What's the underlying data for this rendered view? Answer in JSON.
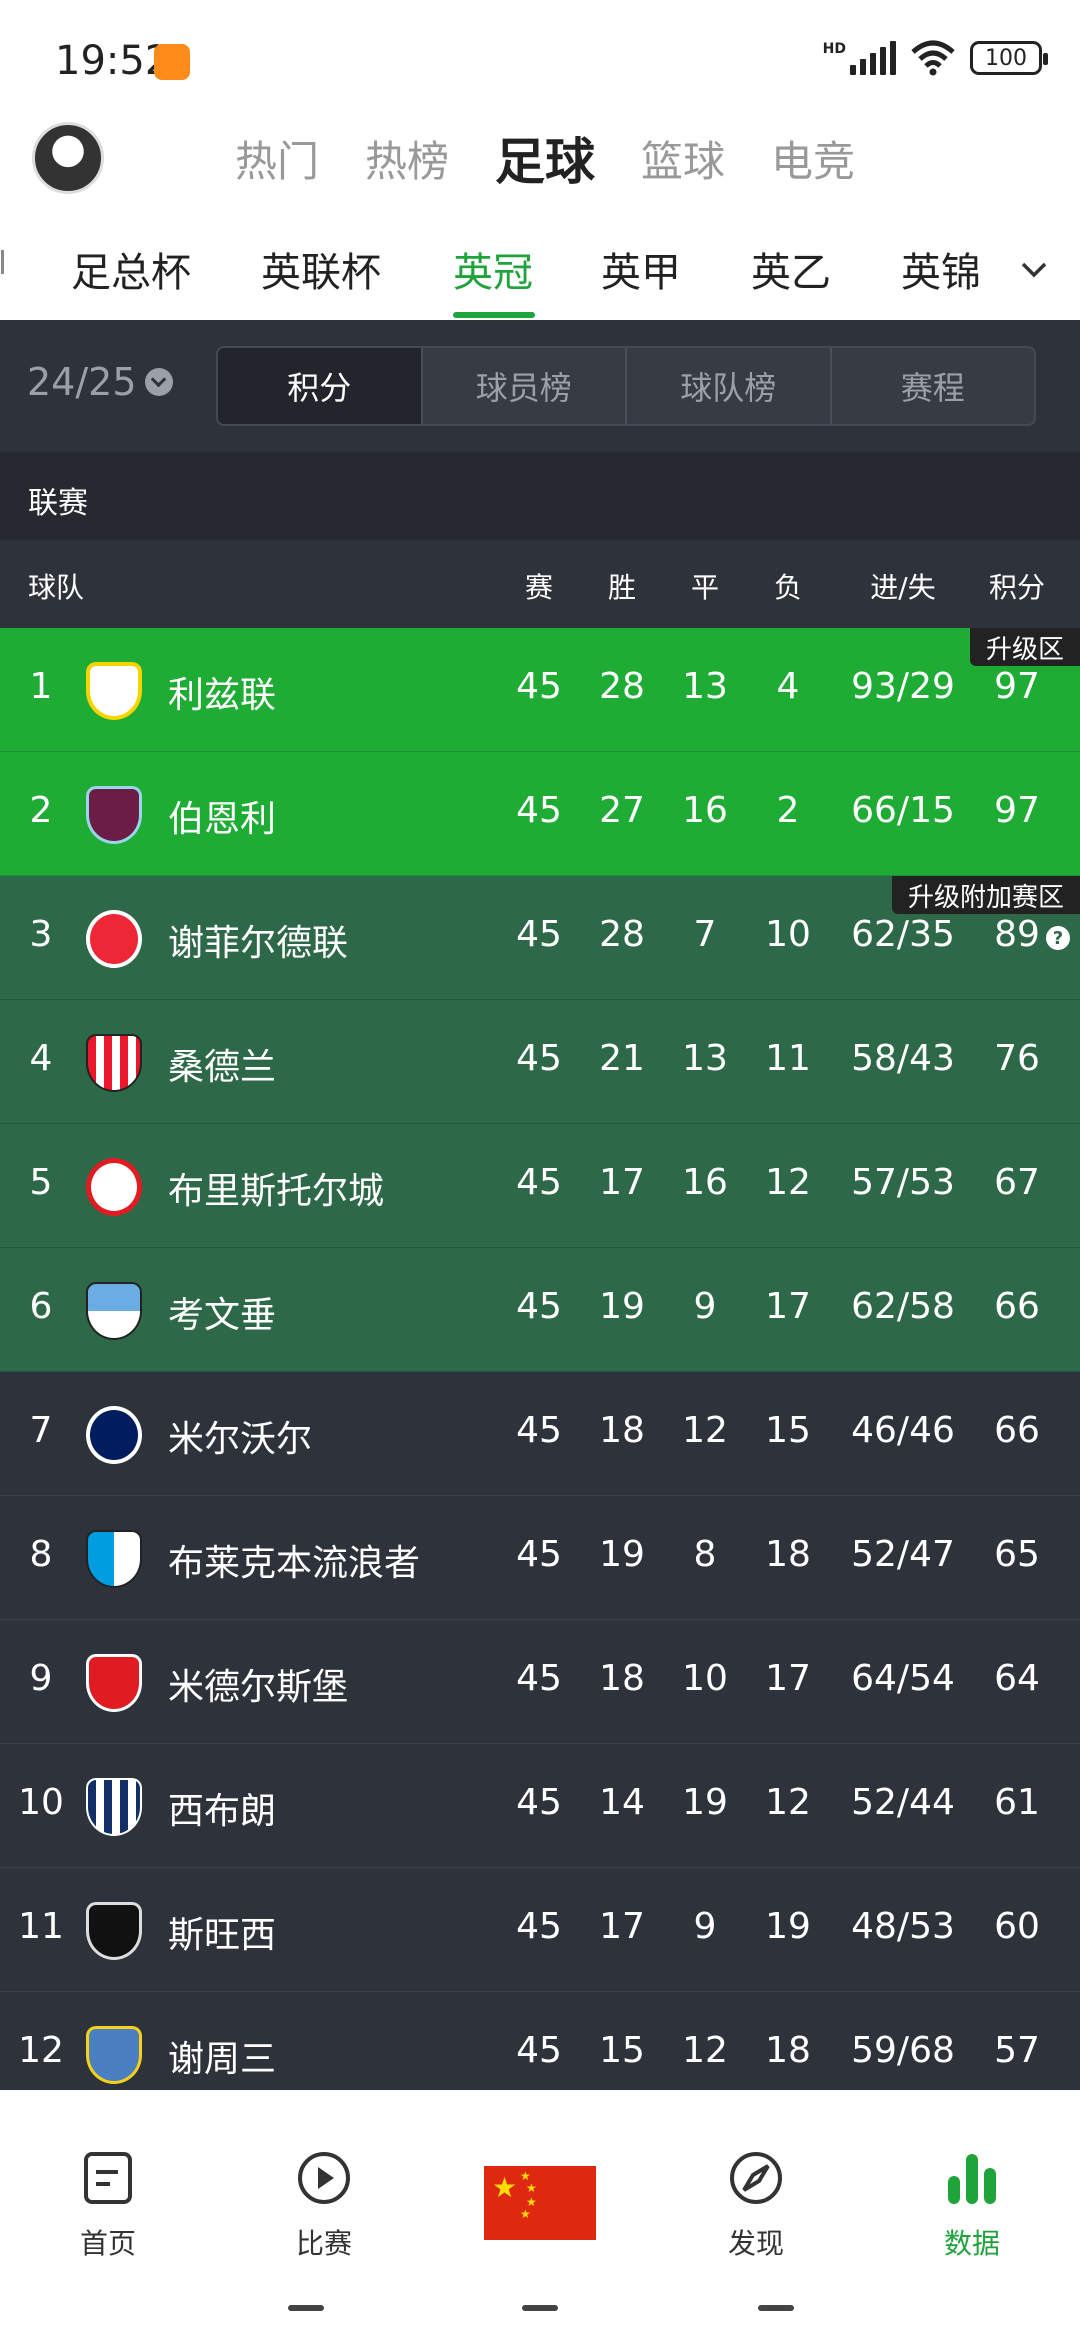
{
  "status": {
    "time": "19:52",
    "battery": "100",
    "network": "HD"
  },
  "main_tabs": [
    {
      "label": "热门",
      "active": false
    },
    {
      "label": "热榜",
      "active": false
    },
    {
      "label": "足球",
      "active": true
    },
    {
      "label": "篮球",
      "active": false
    },
    {
      "label": "电竞",
      "active": false
    }
  ],
  "league_tabs": [
    {
      "label": "足总杯",
      "active": false
    },
    {
      "label": "英联杯",
      "active": false
    },
    {
      "label": "英冠",
      "active": true
    },
    {
      "label": "英甲",
      "active": false
    },
    {
      "label": "英乙",
      "active": false
    },
    {
      "label": "英锦",
      "active": false
    }
  ],
  "season": "24/25",
  "segments": [
    {
      "label": "积分",
      "active": true
    },
    {
      "label": "球员榜",
      "active": false
    },
    {
      "label": "球队榜",
      "active": false
    },
    {
      "label": "赛程",
      "active": false
    }
  ],
  "section_label": "联赛",
  "headers": {
    "team": "球队",
    "played": "赛",
    "won": "胜",
    "drawn": "平",
    "lost": "负",
    "goals": "进/失",
    "points": "积分"
  },
  "zones": {
    "promotion": "升级区",
    "playoff": "升级附加赛区"
  },
  "colors": {
    "accent": "#1fa33b",
    "promotion_row": "#1eac35",
    "playoff_row": "#2d6848",
    "normal_row": "#2e333b"
  },
  "standings": [
    {
      "rank": "1",
      "team": "利兹联",
      "played": "45",
      "won": "28",
      "drawn": "13",
      "lost": "4",
      "goals": "93/29",
      "points": "97"
    },
    {
      "rank": "2",
      "team": "伯恩利",
      "played": "45",
      "won": "27",
      "drawn": "16",
      "lost": "2",
      "goals": "66/15",
      "points": "97"
    },
    {
      "rank": "3",
      "team": "谢菲尔德联",
      "played": "45",
      "won": "28",
      "drawn": "7",
      "lost": "10",
      "goals": "62/35",
      "points": "89"
    },
    {
      "rank": "4",
      "team": "桑德兰",
      "played": "45",
      "won": "21",
      "drawn": "13",
      "lost": "11",
      "goals": "58/43",
      "points": "76"
    },
    {
      "rank": "5",
      "team": "布里斯托尔城",
      "played": "45",
      "won": "17",
      "drawn": "16",
      "lost": "12",
      "goals": "57/53",
      "points": "67"
    },
    {
      "rank": "6",
      "team": "考文垂",
      "played": "45",
      "won": "19",
      "drawn": "9",
      "lost": "17",
      "goals": "62/58",
      "points": "66"
    },
    {
      "rank": "7",
      "team": "米尔沃尔",
      "played": "45",
      "won": "18",
      "drawn": "12",
      "lost": "15",
      "goals": "46/46",
      "points": "66"
    },
    {
      "rank": "8",
      "team": "布莱克本流浪者",
      "played": "45",
      "won": "19",
      "drawn": "8",
      "lost": "18",
      "goals": "52/47",
      "points": "65"
    },
    {
      "rank": "9",
      "team": "米德尔斯堡",
      "played": "45",
      "won": "18",
      "drawn": "10",
      "lost": "17",
      "goals": "64/54",
      "points": "64"
    },
    {
      "rank": "10",
      "team": "西布朗",
      "played": "45",
      "won": "14",
      "drawn": "19",
      "lost": "12",
      "goals": "52/44",
      "points": "61"
    },
    {
      "rank": "11",
      "team": "斯旺西",
      "played": "45",
      "won": "17",
      "drawn": "9",
      "lost": "19",
      "goals": "48/53",
      "points": "60"
    },
    {
      "rank": "12",
      "team": "谢周三",
      "played": "45",
      "won": "15",
      "drawn": "12",
      "lost": "18",
      "goals": "59/68",
      "points": "57"
    }
  ],
  "bottom_nav": [
    {
      "label": "首页",
      "icon": "document-icon",
      "active": false
    },
    {
      "label": "比赛",
      "icon": "play-icon",
      "active": false
    },
    {
      "label": "发现",
      "icon": "compass-icon",
      "active": false
    },
    {
      "label": "数据",
      "icon": "bar-chart-icon",
      "active": true
    }
  ]
}
